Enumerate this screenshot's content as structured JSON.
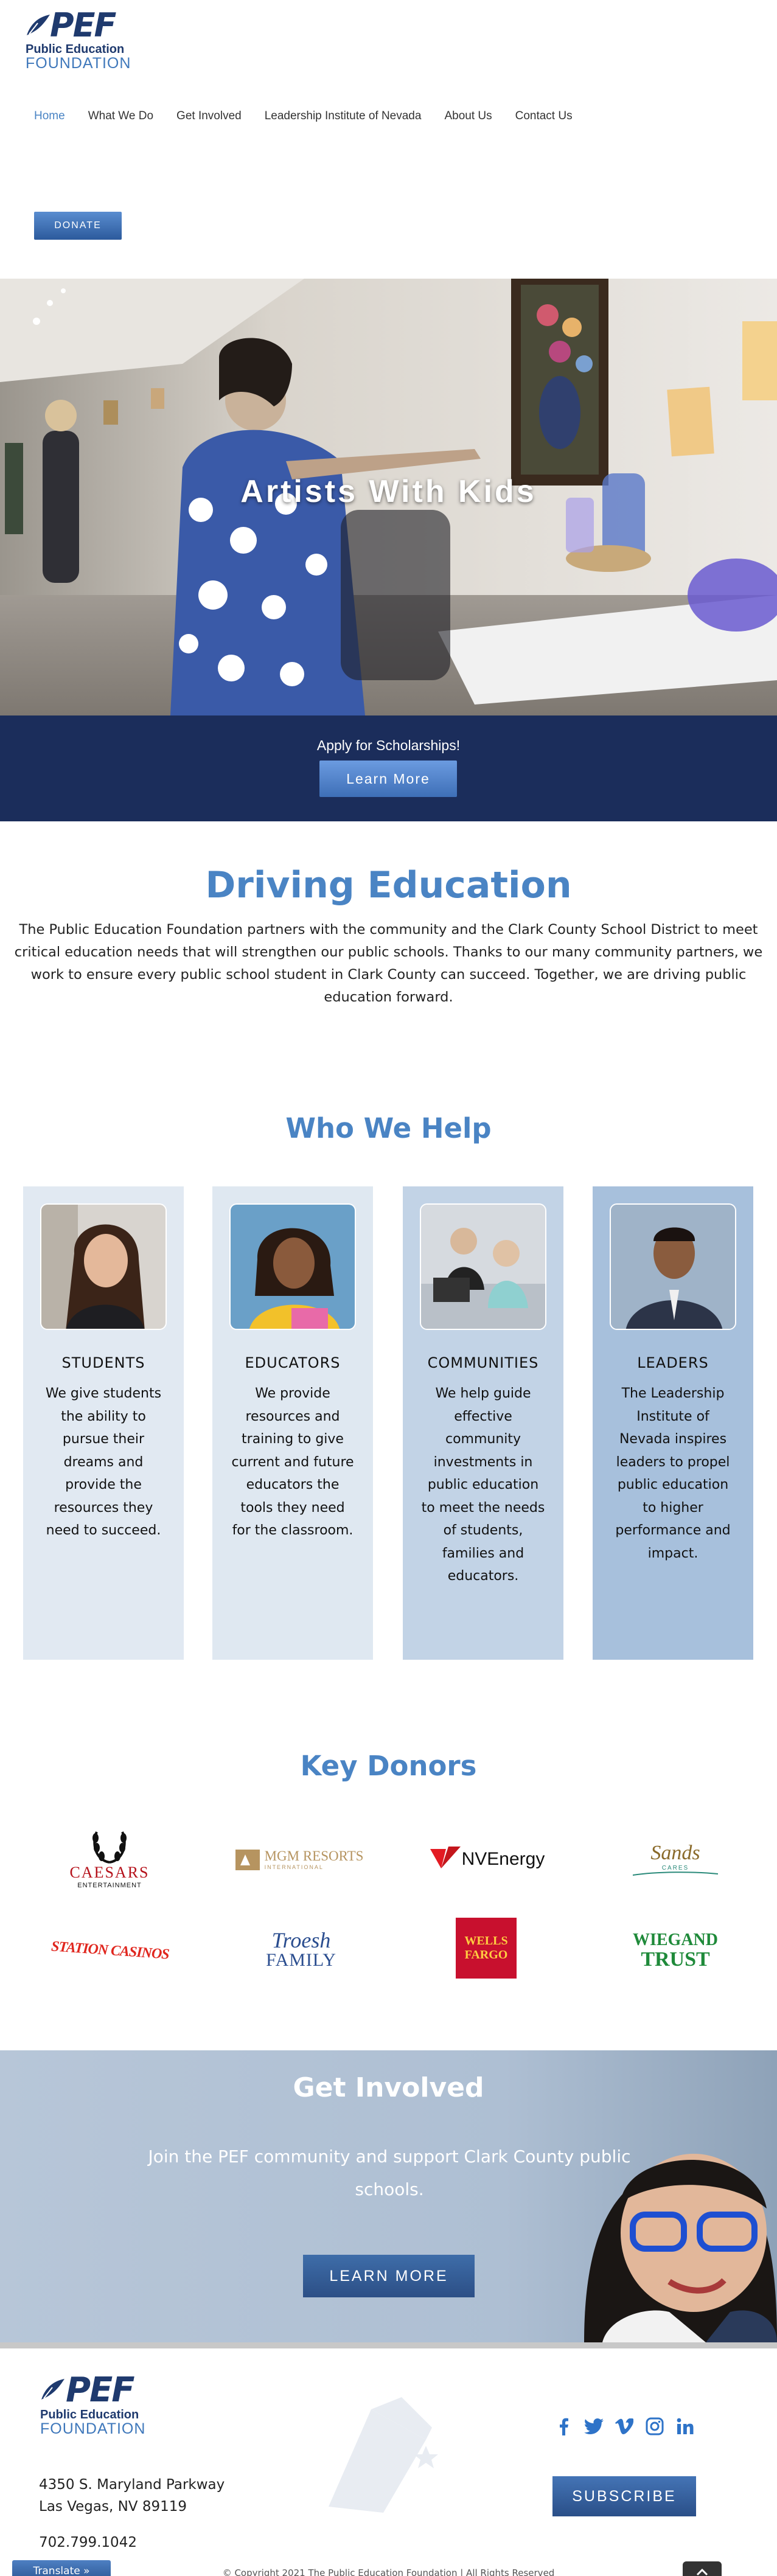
{
  "brand": {
    "pef": "PEF",
    "line1": "Public Education",
    "line2": "FOUNDATION"
  },
  "nav": {
    "items": [
      "Home",
      "What We Do",
      "Get Involved",
      "Leadership Institute of Nevada",
      "About Us",
      "Contact Us"
    ],
    "active": "Home",
    "donate_label": "DONATE"
  },
  "hero": {
    "title": "Artists With Kids",
    "apply_text": "Apply for Scholarships!",
    "learn_label": "Learn More"
  },
  "driving": {
    "title": "Driving Education",
    "text": "The Public Education Foundation partners with the community and the Clark County School District to meet critical education needs that will strengthen our public schools. Thanks to our many community partners, we work to ensure every public school student in Clark County can succeed. Together, we are driving public education forward."
  },
  "who": {
    "title": "Who We Help",
    "cards": [
      {
        "title": "STUDENTS",
        "text": "We give students the ability to pursue their dreams and provide the resources they need to succeed.",
        "bg": "#e1e9f2"
      },
      {
        "title": "EDUCATORS",
        "text": "We provide resources and training to give current and future educators the tools they need for the classroom.",
        "bg": "#dfe8f1"
      },
      {
        "title": "COMMUNITIES",
        "text": "We help guide effective community investments in public education to meet the needs of students, families and educators.",
        "bg": "#c2d3e6"
      },
      {
        "title": "LEADERS",
        "text": "The Leadership Institute of Nevada inspires leaders to propel public education to higher performance and impact.",
        "bg": "#a7c0dc"
      }
    ]
  },
  "donors": {
    "title": "Key Donors",
    "logos": {
      "caesars": "CAESARS",
      "caesars_sub": "ENTERTAINMENT",
      "mgm": "MGM RESORTS",
      "mgm_sub": "INTERNATIONAL",
      "nv": "NVEnergy",
      "sands": "Sands",
      "sands_sub": "CARES",
      "station": "STATION CASINOS",
      "troesh": "Troesh",
      "troesh_sub": "FAMILY",
      "wells1": "WELLS",
      "wells2": "FARGO",
      "wiegand1": "WIEGAND",
      "wiegand2": "TRUST"
    }
  },
  "get_involved": {
    "title": "Get Involved",
    "text": "Join the PEF community and support Clark County public schools.",
    "button": "LEARN MORE"
  },
  "footer": {
    "address1": "4350 S. Maryland Parkway",
    "address2": "Las Vegas, NV 89119",
    "phone": "702.799.1042",
    "subscribe": "SUBSCRIBE",
    "copyright": "© Copyright 2021 The Public Education Foundation | All Rights Reserved",
    "translate": "Translate »"
  },
  "colors": {
    "accent": "#4a84c4",
    "navy": "#1b2d5b",
    "brand_dark": "#1f3a6e"
  }
}
